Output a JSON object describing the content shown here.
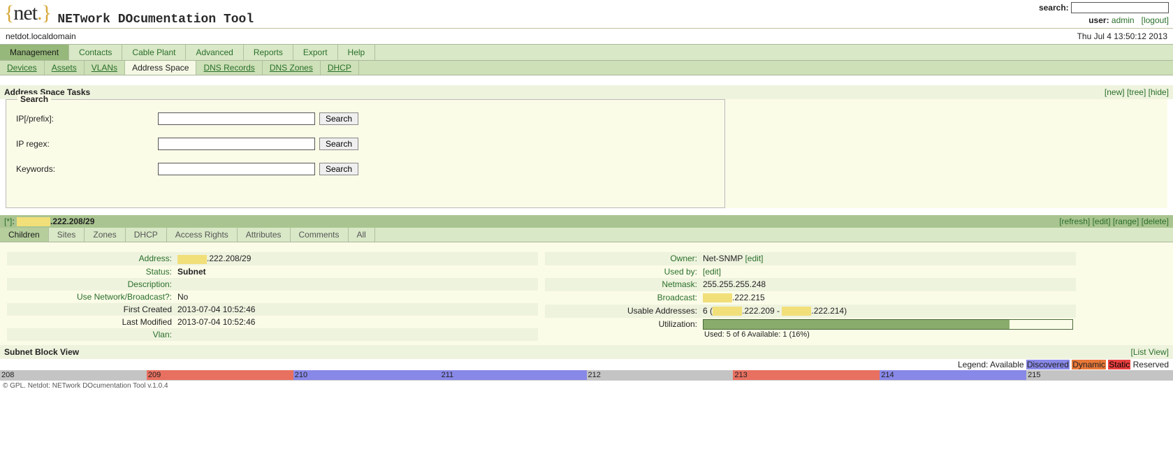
{
  "header": {
    "app_title": "NETwork DOcumentation Tool",
    "search_label": "search",
    "user_label": "user",
    "user_name": "admin",
    "logout": "[logout]",
    "host": "netdot.localdomain",
    "timestamp": "Thu Jul 4 13:50:12 2013"
  },
  "main_tabs": [
    "Management",
    "Contacts",
    "Cable Plant",
    "Advanced",
    "Reports",
    "Export",
    "Help"
  ],
  "sub_tabs": [
    "Devices",
    "Assets",
    "VLANs",
    "Address Space",
    "DNS Records",
    "DNS Zones",
    "DHCP"
  ],
  "tasks": {
    "title": "Address Space Tasks",
    "actions": {
      "new": "[new]",
      "tree": "[tree]",
      "hide": "[hide]"
    },
    "search_legend": "Search",
    "rows": {
      "ip_prefix": {
        "label": "IP[/prefix]:",
        "btn": "Search"
      },
      "ip_regex": {
        "label": "IP regex:",
        "btn": "Search"
      },
      "keywords": {
        "label": "Keywords:",
        "btn": "Search"
      }
    }
  },
  "block": {
    "crumb_root": "[*]",
    "crumb_suffix": ".222.208/29",
    "actions": {
      "refresh": "[refresh]",
      "edit": "[edit]",
      "range": "[range]",
      "delete": "[delete]"
    },
    "obj_tabs": [
      "Children",
      "Sites",
      "Zones",
      "DHCP",
      "Access Rights",
      "Attributes",
      "Comments",
      "All"
    ]
  },
  "details_left": {
    "address": {
      "label": "Address:",
      "suffix": ".222.208/29"
    },
    "status": {
      "label": "Status:",
      "value": "Subnet"
    },
    "description": {
      "label": "Description:",
      "value": ""
    },
    "use_nb": {
      "label": "Use Network/Broadcast?:",
      "value": "No"
    },
    "first_created": {
      "label": "First Created",
      "value": "2013-07-04 10:52:46"
    },
    "last_modified": {
      "label": "Last Modified",
      "value": "2013-07-04 10:52:46"
    },
    "vlan": {
      "label": "Vlan:",
      "value": ""
    }
  },
  "details_right": {
    "owner": {
      "label": "Owner:",
      "value": "Net-SNMP",
      "edit": "[edit]"
    },
    "used_by": {
      "label": "Used by:",
      "edit": "[edit]"
    },
    "netmask": {
      "label": "Netmask:",
      "value": "255.255.255.248"
    },
    "broadcast": {
      "label": "Broadcast:",
      "suffix": ".222.215"
    },
    "usable": {
      "label": "Usable Addresses:",
      "prefix": "6 (",
      "mid1": ".222.209 - ",
      "suffix": ".222.214)"
    },
    "utilization": {
      "label": "Utilization:",
      "bar_pct": 83,
      "text": "Used: 5 of 6   Available: 1  (16%)"
    }
  },
  "subnet": {
    "title": "Subnet Block View",
    "list_view": "[List View]",
    "legend_label": "Legend:",
    "legend": {
      "available": "Available",
      "discovered": "Discovered",
      "dynamic": "Dynamic",
      "static": "Static",
      "reserved": "Reserved"
    },
    "cells": [
      {
        "n": "208",
        "cls": "c-avail",
        "w": "12.5%"
      },
      {
        "n": "209",
        "cls": "c-stat",
        "w": "12.5%"
      },
      {
        "n": "210",
        "cls": "c-disc",
        "w": "12.5%"
      },
      {
        "n": "211",
        "cls": "c-disc",
        "w": "12.5%"
      },
      {
        "n": "212",
        "cls": "c-avail",
        "w": "12.5%"
      },
      {
        "n": "213",
        "cls": "c-stat",
        "w": "12.5%"
      },
      {
        "n": "214",
        "cls": "c-disc",
        "w": "12.5%"
      },
      {
        "n": "215",
        "cls": "c-avail",
        "w": "12.5%"
      }
    ]
  },
  "footer": "© GPL. Netdot: NETwork DOcumentation Tool v.1.0.4"
}
